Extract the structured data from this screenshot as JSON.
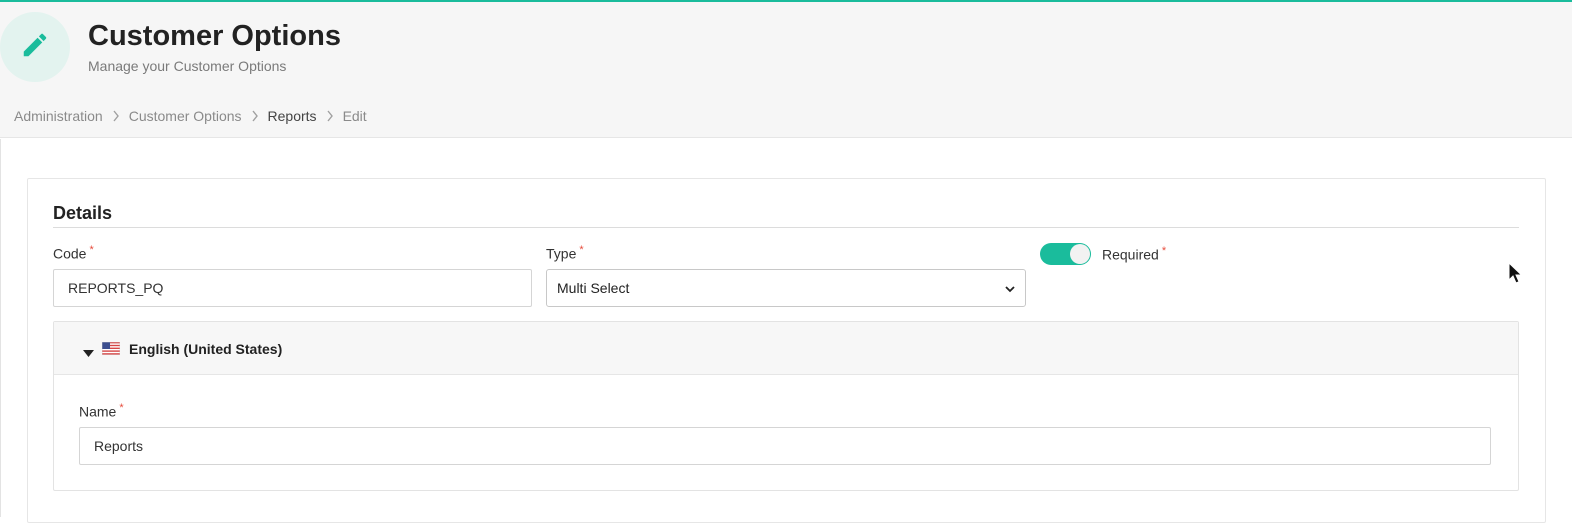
{
  "header": {
    "title": "Customer Options",
    "subtitle": "Manage your Customer Options",
    "icon": "pencil-icon"
  },
  "breadcrumb": {
    "items": [
      "Administration",
      "Customer Options",
      "Reports",
      "Edit"
    ]
  },
  "details": {
    "title": "Details",
    "code": {
      "label": "Code",
      "required_mark": "*",
      "value": "REPORTS_PQ"
    },
    "type": {
      "label": "Type",
      "required_mark": "*",
      "selected": "Multi Select"
    },
    "required": {
      "label": "Required",
      "required_mark": "*",
      "on": true
    }
  },
  "language": {
    "label": "English (United States)",
    "name": {
      "label": "Name",
      "required_mark": "*",
      "value": "Reports"
    }
  },
  "colors": {
    "accent": "#1abc9c",
    "required": "#e74c3c"
  }
}
